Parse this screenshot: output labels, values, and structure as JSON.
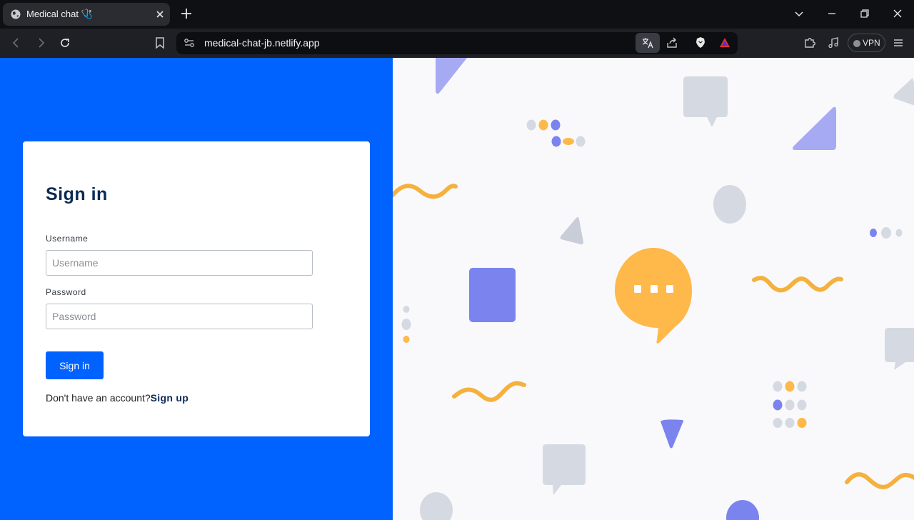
{
  "browser": {
    "tab_title": "Medical chat 🩺",
    "url": "medical-chat-jb.netlify.app",
    "vpn_label": "VPN"
  },
  "signin": {
    "title": "Sign in",
    "username_label": "Username",
    "username_placeholder": "Username",
    "password_label": "Password",
    "password_placeholder": "Password",
    "button_label": "Sign in",
    "no_account_text": "Don't have an account?",
    "signup_link": "Sign up"
  },
  "colors": {
    "primary_blue": "#0062ff",
    "title_navy": "#0b2a55",
    "accent_yellow": "#ffb84a",
    "accent_periwinkle": "#7b84ee",
    "accent_gray": "#d5d9e2"
  }
}
